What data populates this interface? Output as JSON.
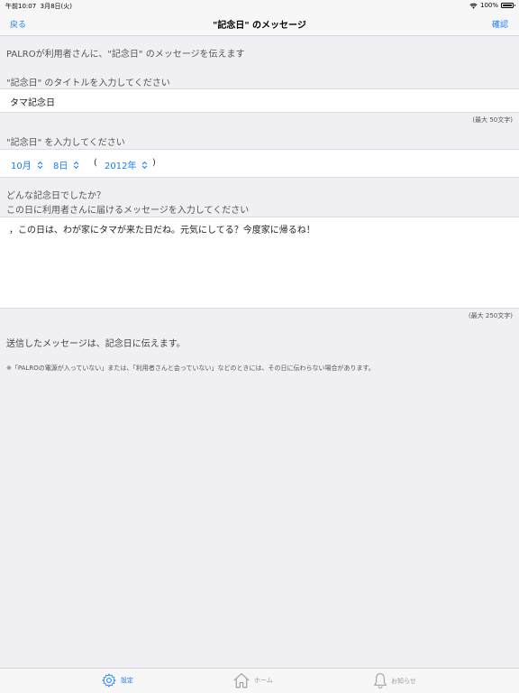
{
  "status_bar": {
    "time": "午前10:07",
    "date": "3月8日(火)",
    "battery": "100%"
  },
  "nav": {
    "back_label": "戻る",
    "title": "\"記念日\" のメッセージ",
    "confirm_label": "確認"
  },
  "intro": "PALROが利用者さんに、\"記念日\" のメッセージを伝えます",
  "title_section": {
    "label": "\"記念日\" のタイトルを入力してください",
    "value": "タマ記念日",
    "limit": "(最大 50文字)"
  },
  "date_section": {
    "label": "\"記念日\" を入力してください",
    "month": "10月",
    "day": "8日",
    "open_paren": "(",
    "year": "2012年",
    "close_paren": ")"
  },
  "message_section": {
    "label_line1": "どんな記念日でしたか？",
    "label_line2": "この日に利用者さんに届けるメッセージを入力してください",
    "value": "，この日は、わが家にタマが来た日だね。元気にしてる？今度家に帰るね！",
    "limit": "(最大 250文字)"
  },
  "notes": {
    "main": "送信したメッセージは、記念日に伝えます。",
    "sub": "※「PALROの電源が入っていない」または、「利用者さんと会っていない」などのときには、その日に伝わらない場合があります。"
  },
  "tabs": [
    {
      "label": "設定",
      "icon": "gear-icon",
      "active": true
    },
    {
      "label": "ホーム",
      "icon": "home-icon",
      "active": false
    },
    {
      "label": "お知らせ",
      "icon": "bell-icon",
      "active": false
    }
  ],
  "colors": {
    "accent": "#1a7cf5",
    "background": "#efeff4"
  }
}
